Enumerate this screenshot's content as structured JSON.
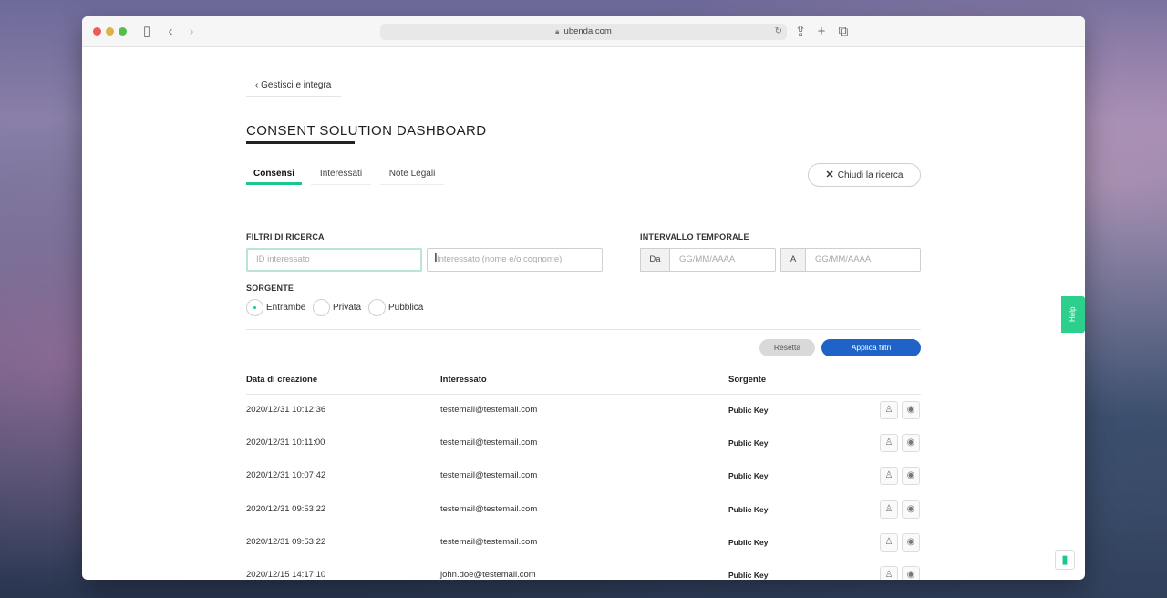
{
  "browser": {
    "address": "iubenda.com"
  },
  "page": {
    "back_link": "‹ Gestisci e integra",
    "title": "CONSENT SOLUTION DASHBOARD",
    "tabs": [
      {
        "label": "Consensi",
        "active": true
      },
      {
        "label": "Interessati",
        "active": false
      },
      {
        "label": "Note Legali",
        "active": false
      }
    ],
    "close_search_label": "Chiudi la ricerca"
  },
  "filters": {
    "label": "FILTRI DI RICERCA",
    "id_placeholder": "ID interessato",
    "name_placeholder": "Interessato (nome e/o cognome)",
    "interval_label": "INTERVALLO TEMPORALE",
    "from_addon": "Da",
    "from_placeholder": "GG/MM/AAAA",
    "to_addon": "A",
    "to_placeholder": "GG/MM/AAAA",
    "source_label": "SORGENTE",
    "source_options": [
      {
        "label": "Entrambe",
        "checked": true
      },
      {
        "label": "Privata",
        "checked": false
      },
      {
        "label": "Pubblica",
        "checked": false
      }
    ],
    "reset_label": "Resetta",
    "apply_label": "Applica filtri"
  },
  "table": {
    "headers": [
      "Data di creazione",
      "Interessato",
      "Sorgente"
    ],
    "rows": [
      {
        "date": "2020/12/31 10:12:36",
        "subject": "testemail@testemail.com",
        "source": "Public Key"
      },
      {
        "date": "2020/12/31 10:11:00",
        "subject": "testemail@testemail.com",
        "source": "Public Key"
      },
      {
        "date": "2020/12/31 10:07:42",
        "subject": "testemail@testemail.com",
        "source": "Public Key"
      },
      {
        "date": "2020/12/31 09:53:22",
        "subject": "testemail@testemail.com",
        "source": "Public Key"
      },
      {
        "date": "2020/12/31 09:53:22",
        "subject": "testemail@testemail.com",
        "source": "Public Key"
      },
      {
        "date": "2020/12/15 14:17:10",
        "subject": "john.doe@testemail.com",
        "source": "Public Key"
      }
    ]
  },
  "help_label": "Help",
  "colors": {
    "accent_green": "#1cc691",
    "primary_blue": "#1f63c6"
  }
}
